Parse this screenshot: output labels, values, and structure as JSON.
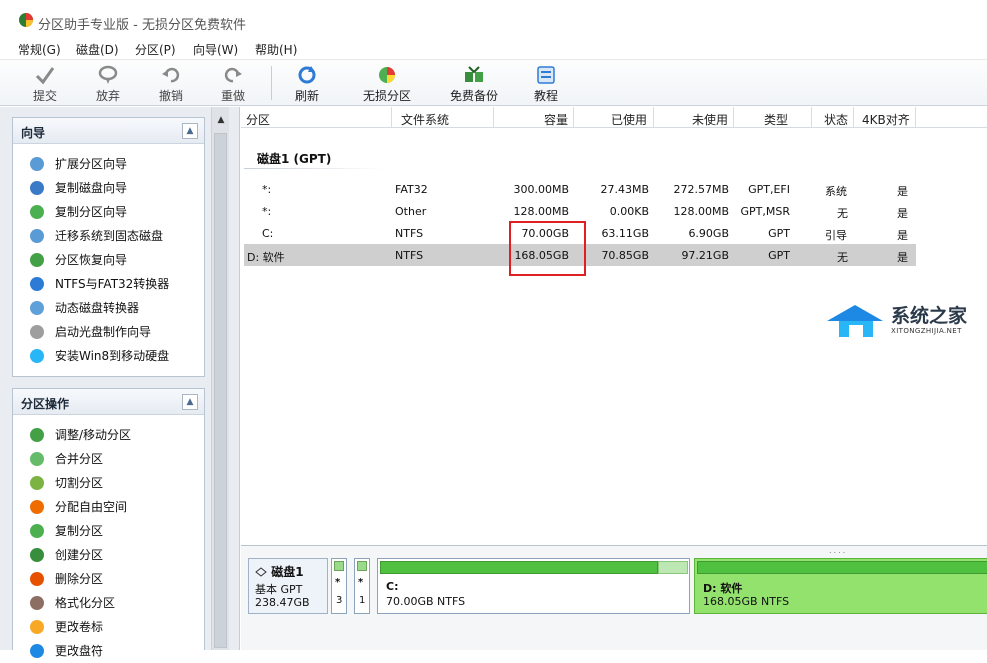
{
  "app": {
    "title": "分区助手专业版 - 无损分区免费软件"
  },
  "menu": [
    "常规(G)",
    "磁盘(D)",
    "分区(P)",
    "向导(W)",
    "帮助(H)"
  ],
  "toolbar": {
    "commit": "提交",
    "discard": "放弃",
    "undo": "撤销",
    "redo": "重做",
    "refresh": "刷新",
    "lossless": "无损分区",
    "backup": "免费备份",
    "tutorial": "教程"
  },
  "wizard_panel": {
    "title": "向导",
    "items": [
      "扩展分区向导",
      "复制磁盘向导",
      "复制分区向导",
      "迁移系统到固态磁盘",
      "分区恢复向导",
      "NTFS与FAT32转换器",
      "动态磁盘转换器",
      "启动光盘制作向导",
      "安装Win8到移动硬盘"
    ]
  },
  "ops_panel": {
    "title": "分区操作",
    "items": [
      "调整/移动分区",
      "合并分区",
      "切割分区",
      "分配自由空间",
      "复制分区",
      "创建分区",
      "删除分区",
      "格式化分区",
      "更改卷标",
      "更改盘符"
    ]
  },
  "table": {
    "headers": [
      "分区",
      "文件系统",
      "容量",
      "已使用",
      "未使用",
      "类型",
      "状态",
      "4KB对齐"
    ],
    "disk_label": "磁盘1 (GPT)",
    "rows": [
      {
        "partition": "*:",
        "fs": "FAT32",
        "capacity": "300.00MB",
        "used": "27.43MB",
        "free": "272.57MB",
        "type": "GPT,EFI",
        "status": "系统",
        "align": "是"
      },
      {
        "partition": "*:",
        "fs": "Other",
        "capacity": "128.00MB",
        "used": "0.00KB",
        "free": "128.00MB",
        "type": "GPT,MSR",
        "status": "无",
        "align": "是"
      },
      {
        "partition": "C:",
        "fs": "NTFS",
        "capacity": "70.00GB",
        "used": "63.11GB",
        "free": "6.90GB",
        "type": "GPT",
        "status": "引导",
        "align": "是"
      },
      {
        "partition": "D: 软件",
        "fs": "NTFS",
        "capacity": "168.05GB",
        "used": "70.85GB",
        "free": "97.21GB",
        "type": "GPT",
        "status": "无",
        "align": "是"
      }
    ],
    "selected_row": 3
  },
  "watermark": {
    "title": "系统之家",
    "sub": "XITONGZHIJIA.NET"
  },
  "diskmap": {
    "disk_name": "磁盘1",
    "disk_type": "基本 GPT",
    "disk_size": "238.47GB",
    "mini": [
      {
        "label": "*",
        "num": "3"
      },
      {
        "label": "*",
        "num": "1"
      }
    ],
    "partitions": [
      {
        "name": "C:",
        "size": "70.00GB NTFS",
        "used_fraction": 0.9
      },
      {
        "name": "D: 软件",
        "size": "168.05GB NTFS",
        "used_fraction": 0.42
      }
    ]
  },
  "colors": {
    "selection": "#cfcfcf",
    "highlight_box": "#e02020",
    "partition_fill": "#50c040"
  }
}
